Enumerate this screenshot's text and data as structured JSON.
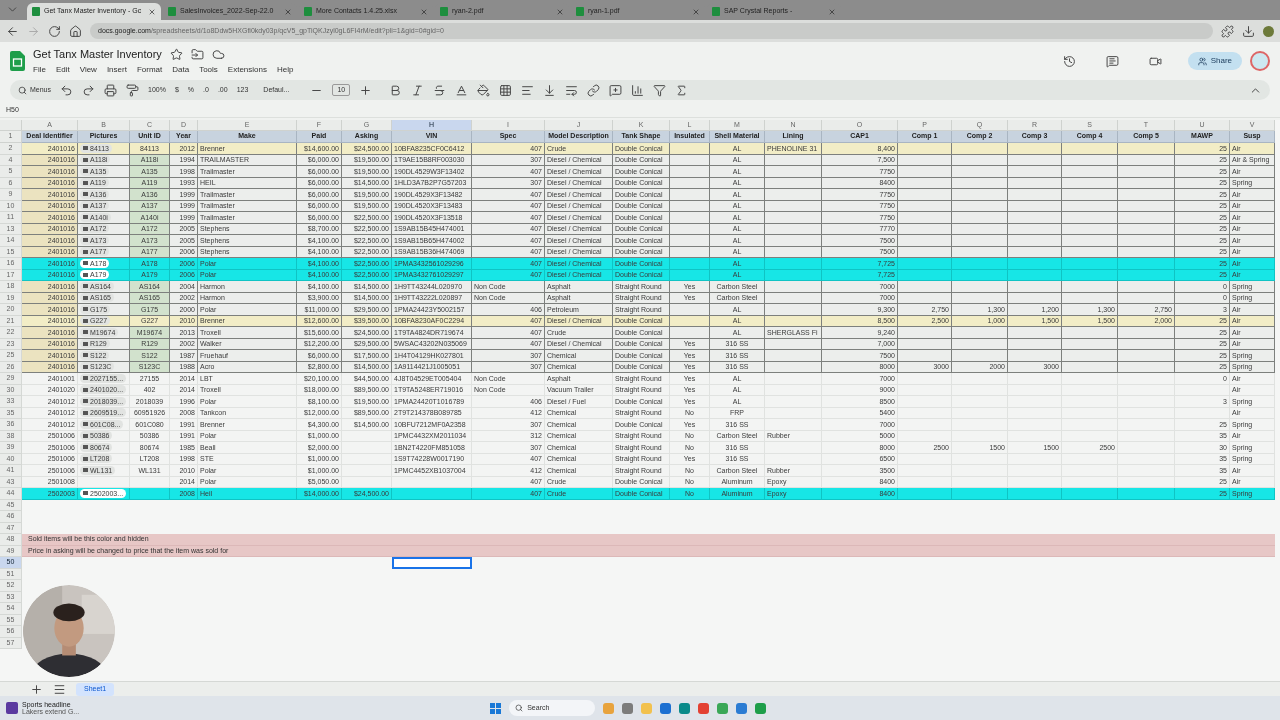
{
  "browser": {
    "tabs": [
      {
        "title": "Get Tanx Master Inventory - Gc",
        "selected": true
      },
      {
        "title": "SalesInvoices_2022-Sep-22.0",
        "selected": false
      },
      {
        "title": "More Contacts 1.4.25.xlsx",
        "selected": false
      },
      {
        "title": "ryan-2.pdf",
        "selected": false
      },
      {
        "title": "ryan-1.pdf",
        "selected": false
      },
      {
        "title": "SAP Crystal Reports -",
        "selected": false
      }
    ],
    "url_host": "docs.google.com",
    "url_path": "/spreadsheets/d/1o8Ddw5HXGfi0kdy03p/qcV5_gpTiQKJzyl0gL6FI4rM/edit?pli=1&gid=0#gid=0"
  },
  "document": {
    "title": "Get Tanx Master Inventory",
    "menus": [
      "File",
      "Edit",
      "View",
      "Insert",
      "Format",
      "Data",
      "Tools",
      "Extensions",
      "Help"
    ],
    "share": "Share"
  },
  "toolbar": {
    "search": "Menus",
    "zoom": "100%",
    "currency": "$",
    "percent": "%",
    "decrease_decimal": ".0",
    "increase_decimal": ".00",
    "number_format": "123",
    "font": "Defaul...",
    "font_size": "10"
  },
  "formula_bar": {
    "cell_ref": "H50"
  },
  "sheet": {
    "header_row": "1",
    "columns": [
      {
        "letter": "A",
        "selected": false,
        "header": "Deal Identifier"
      },
      {
        "letter": "B",
        "selected": false,
        "header": "Pictures"
      },
      {
        "letter": "C",
        "selected": false,
        "header": "Unit ID"
      },
      {
        "letter": "D",
        "selected": false,
        "header": "Year"
      },
      {
        "letter": "E",
        "selected": false,
        "header": "Make"
      },
      {
        "letter": "F",
        "selected": false,
        "header": "Paid"
      },
      {
        "letter": "G",
        "selected": false,
        "header": "Asking"
      },
      {
        "letter": "H",
        "selected": true,
        "header": "VIN"
      },
      {
        "letter": "I",
        "selected": false,
        "header": "Spec"
      },
      {
        "letter": "J",
        "selected": false,
        "header": "Model Description"
      },
      {
        "letter": "K",
        "selected": false,
        "header": "Tank Shape"
      },
      {
        "letter": "L",
        "selected": false,
        "header": "Insulated"
      },
      {
        "letter": "M",
        "selected": false,
        "header": "Shell Material"
      },
      {
        "letter": "N",
        "selected": false,
        "header": "Lining"
      },
      {
        "letter": "O",
        "selected": false,
        "header": "CAP1"
      },
      {
        "letter": "P",
        "selected": false,
        "header": "Comp 1"
      },
      {
        "letter": "Q",
        "selected": false,
        "header": "Comp 2"
      },
      {
        "letter": "R",
        "selected": false,
        "header": "Comp 3"
      },
      {
        "letter": "S",
        "selected": false,
        "header": "Comp 4"
      },
      {
        "letter": "T",
        "selected": false,
        "header": "Comp 5"
      },
      {
        "letter": "U",
        "selected": false,
        "header": "MAWP"
      },
      {
        "letter": "V",
        "selected": false,
        "header": "Susp"
      }
    ],
    "rows": [
      {
        "row": "2",
        "kind": "highlight",
        "selected": false,
        "cells": [
          "2401016",
          "84113",
          "84113",
          "2012",
          "Brenner",
          "$14,600.00",
          "$24,500.00",
          "10BFA8235CF0C6412",
          "407",
          "Crude",
          "Double Conical",
          null,
          "AL",
          "PHENOLINE 31",
          "8,400",
          null,
          null,
          null,
          null,
          null,
          "25",
          "Air"
        ]
      },
      {
        "row": "4",
        "kind": "listed",
        "selected": false,
        "cells": [
          "2401016",
          "A118i",
          "A118i",
          "1994",
          "TRAILMASTER",
          "$6,000.00",
          "$19,500.00",
          "1T9AE15B8RF003030",
          "307",
          "Diesel / Chemical",
          "Double Conical",
          null,
          "AL",
          null,
          "7,500",
          null,
          null,
          null,
          null,
          null,
          "25",
          "Air & Spring"
        ]
      },
      {
        "row": "5",
        "kind": "listed",
        "selected": false,
        "cells": [
          "2401016",
          "A135",
          "A135",
          "1998",
          "Trailmaster",
          "$6,000.00",
          "$19,500.00",
          "190DL4529W3F13402",
          "407",
          "Diesel / Chemical",
          "Double Conical",
          null,
          "AL",
          null,
          "7750",
          null,
          null,
          null,
          null,
          null,
          "25",
          "Air"
        ]
      },
      {
        "row": "6",
        "kind": "listed",
        "selected": false,
        "cells": [
          "2401016",
          "A119",
          "A119",
          "1993",
          "HEIL",
          "$6,000.00",
          "$14,500.00",
          "1HLD3A7B2P7G57203",
          "307",
          "Diesel / Chemical",
          "Double Conical",
          null,
          "AL",
          null,
          "8400",
          null,
          null,
          null,
          null,
          null,
          "25",
          "Spring"
        ]
      },
      {
        "row": "9",
        "kind": "listed",
        "selected": false,
        "cells": [
          "2401016",
          "A136",
          "A136",
          "1999",
          "Trailmaster",
          "$6,000.00",
          "$19,500.00",
          "190DL4529X3F13482",
          "407",
          "Diesel / Chemical",
          "Double Conical",
          null,
          "AL",
          null,
          "7750",
          null,
          null,
          null,
          null,
          null,
          "25",
          "Air"
        ]
      },
      {
        "row": "10",
        "kind": "listed",
        "selected": false,
        "cells": [
          "2401016",
          "A137",
          "A137",
          "1999",
          "Trailmaster",
          "$6,000.00",
          "$19,500.00",
          "190DL4520X3F13483",
          "407",
          "Diesel / Chemical",
          "Double Conical",
          null,
          "AL",
          null,
          "7750",
          null,
          null,
          null,
          null,
          null,
          "25",
          "Air"
        ]
      },
      {
        "row": "11",
        "kind": "listed",
        "selected": false,
        "cells": [
          "2401016",
          "A140i",
          "A140i",
          "1999",
          "Trailmaster",
          "$6,000.00",
          "$22,500.00",
          "190DL4520X3F13518",
          "407",
          "Diesel / Chemical",
          "Double Conical",
          null,
          "AL",
          null,
          "7750",
          null,
          null,
          null,
          null,
          null,
          "25",
          "Air"
        ]
      },
      {
        "row": "13",
        "kind": "listed",
        "selected": false,
        "cells": [
          "2401016",
          "A172",
          "A172",
          "2005",
          "Stephens",
          "$8,700.00",
          "$22,500.00",
          "1S9AB15B45H474001",
          "407",
          "Diesel / Chemical",
          "Double Conical",
          null,
          "AL",
          null,
          "7770",
          null,
          null,
          null,
          null,
          null,
          "25",
          "Air"
        ]
      },
      {
        "row": "14",
        "kind": "listed",
        "selected": false,
        "cells": [
          "2401016",
          "A173",
          "A173",
          "2005",
          "Stephens",
          "$4,100.00",
          "$22,500.00",
          "1S9AB15B65H474002",
          "407",
          "Diesel / Chemical",
          "Double Conical",
          null,
          "AL",
          null,
          "7500",
          null,
          null,
          null,
          null,
          null,
          "25",
          "Air"
        ]
      },
      {
        "row": "15",
        "kind": "listed",
        "selected": false,
        "cells": [
          "2401016",
          "A177",
          "A177",
          "2006",
          "Stephens",
          "$4,100.00",
          "$22,500.00",
          "1S9AB15B36H474069",
          "407",
          "Diesel / Chemical",
          "Double Conical",
          null,
          "AL",
          null,
          "7500",
          null,
          null,
          null,
          null,
          null,
          "25",
          "Air"
        ]
      },
      {
        "row": "16",
        "kind": "sold",
        "selected": false,
        "cells": [
          "2401016",
          "A178",
          "A178",
          "2006",
          "Polar",
          "$4,100.00",
          "$22,500.00",
          "1PMA3432561029296",
          "407",
          "Diesel / Chemical",
          "Double Conical",
          null,
          "AL",
          null,
          "7,725",
          null,
          null,
          null,
          null,
          null,
          "25",
          "Air"
        ]
      },
      {
        "row": "17",
        "kind": "sold",
        "selected": false,
        "cells": [
          "2401016",
          "A179",
          "A179",
          "2006",
          "Polar",
          "$4,100.00",
          "$22,500.00",
          "1PMA3432761029297",
          "407",
          "Diesel / Chemical",
          "Double Conical",
          null,
          "AL",
          null,
          "7,725",
          null,
          null,
          null,
          null,
          null,
          "25",
          "Air"
        ]
      },
      {
        "row": "18",
        "kind": "listed",
        "selected": false,
        "cells": [
          "2401016",
          "AS164",
          "AS164",
          "2004",
          "Harmon",
          "$4,100.00",
          "$14,500.00",
          "1H9TT43244L020970",
          "Non Code",
          "Asphalt",
          "Straight Round",
          "Yes",
          "Carbon Steel",
          null,
          "7000",
          null,
          null,
          null,
          null,
          null,
          "0",
          "Spring"
        ]
      },
      {
        "row": "19",
        "kind": "listed",
        "selected": false,
        "cells": [
          "2401016",
          "AS165",
          "AS165",
          "2002",
          "Harmon",
          "$3,900.00",
          "$14,500.00",
          "1H9TT43222L020897",
          "Non Code",
          "Asphalt",
          "Straight Round",
          "Yes",
          "Carbon Steel",
          null,
          "7000",
          null,
          null,
          null,
          null,
          null,
          "0",
          "Spring"
        ]
      },
      {
        "row": "20",
        "kind": "listed",
        "selected": false,
        "cells": [
          "2401016",
          "G175",
          "G175",
          "2000",
          "Polar",
          "$11,000.00",
          "$29,500.00",
          "1PMA24423Y5002157",
          "406",
          "Petroleum",
          "Straight Round",
          null,
          "AL",
          null,
          "9,300",
          "2,750",
          "1,300",
          "1,200",
          "1,300",
          "2,750",
          "3",
          "Air"
        ]
      },
      {
        "row": "21",
        "kind": "highlight",
        "selected": false,
        "cells": [
          "2401016",
          "G227",
          "G227",
          "2010",
          "Brenner",
          "$12,600.00",
          "$39,500.00",
          "10BFA8230AF0C2294",
          "407",
          "Diesel / Chemical",
          "Double Conical",
          null,
          "AL",
          null,
          "8,500",
          "2,500",
          "1,000",
          "1,500",
          "1,500",
          "2,000",
          "25",
          "Air"
        ]
      },
      {
        "row": "22",
        "kind": "listed",
        "selected": false,
        "cells": [
          "2401016",
          "M19674",
          "M19674",
          "2013",
          "Troxell",
          "$15,600.00",
          "$24,500.00",
          "1T9TA4824DR719674",
          "407",
          "Crude",
          "Double Conical",
          null,
          "AL",
          "SHERGLASS Fi",
          "9,240",
          null,
          null,
          null,
          null,
          null,
          "25",
          "Air"
        ]
      },
      {
        "row": "23",
        "kind": "listed",
        "selected": false,
        "cells": [
          "2401016",
          "R129",
          "R129",
          "2002",
          "Walker",
          "$12,200.00",
          "$29,500.00",
          "5WSAC43202N035069",
          "407",
          "Diesel / Chemical",
          "Double Conical",
          "Yes",
          "316 SS",
          null,
          "7,000",
          null,
          null,
          null,
          null,
          null,
          "25",
          "Air"
        ]
      },
      {
        "row": "25",
        "kind": "listed",
        "selected": false,
        "cells": [
          "2401016",
          "S122",
          "S122",
          "1987",
          "Fruehauf",
          "$6,000.00",
          "$17,500.00",
          "1H4T04129HK027801",
          "307",
          "Chemical",
          "Double Conical",
          "Yes",
          "316 SS",
          null,
          "7500",
          null,
          null,
          null,
          null,
          null,
          "25",
          "Spring"
        ]
      },
      {
        "row": "26",
        "kind": "listed",
        "selected": false,
        "cells": [
          "2401016",
          "S123C",
          "S123C",
          "1988",
          "Acro",
          "$2,800.00",
          "$14,500.00",
          "1A9114421J1005051",
          "307",
          "Chemical",
          "Double Conical",
          "Yes",
          "316 SS",
          null,
          "8000",
          "3000",
          "2000",
          "3000",
          null,
          null,
          "25",
          "Spring"
        ]
      },
      {
        "row": "29",
        "kind": "plain",
        "selected": false,
        "cells": [
          "2401001",
          "2027155...",
          "27155",
          "2014",
          "LBT",
          "$20,100.00",
          "$44,500.00",
          "4J8T04529ET005404",
          "Non Code",
          "Asphalt",
          "Straight Round",
          "Yes",
          "AL",
          null,
          "7000",
          null,
          null,
          null,
          null,
          null,
          "0",
          "Air"
        ]
      },
      {
        "row": "30",
        "kind": "plain",
        "selected": false,
        "cells": [
          "2401020",
          "2401020...",
          "402",
          "2014",
          "Troxell",
          "$18,000.00",
          "$89,500.00",
          "1T9TA5248ER719016",
          "Non Code",
          "Vacuum Trailer",
          "Straight Round",
          "Yes",
          "AL",
          null,
          "9000",
          null,
          null,
          null,
          null,
          null,
          null,
          "Air"
        ]
      },
      {
        "row": "33",
        "kind": "plain",
        "selected": false,
        "cells": [
          "2401012",
          "2018039...",
          "2018039",
          "1996",
          "Polar",
          "$8,100.00",
          "$19,500.00",
          "1PMA24420T1016789",
          "406",
          "Diesel / Fuel",
          "Double Conical",
          "Yes",
          "AL",
          null,
          "8500",
          null,
          null,
          null,
          null,
          null,
          "3",
          "Spring"
        ]
      },
      {
        "row": "35",
        "kind": "plain",
        "selected": false,
        "cells": [
          "2401012",
          "2609519...",
          "60951926",
          "2008",
          "Tankcon",
          "$12,000.00",
          "$89,500.00",
          "2T9T214378B089785",
          "412",
          "Chemical",
          "Straight Round",
          "No",
          "FRP",
          null,
          "5400",
          null,
          null,
          null,
          null,
          null,
          null,
          "Air"
        ]
      },
      {
        "row": "36",
        "kind": "plain",
        "selected": false,
        "cells": [
          "2401012",
          "601C08...",
          "601C080",
          "1991",
          "Brenner",
          "$4,300.00",
          "$14,500.00",
          "10BFU7212MF0A2358",
          "307",
          "Chemical",
          "Double Conical",
          "Yes",
          "316 SS",
          null,
          "7000",
          null,
          null,
          null,
          null,
          null,
          "25",
          "Spring"
        ]
      },
      {
        "row": "38",
        "kind": "plain",
        "selected": false,
        "cells": [
          "2501006",
          "50386",
          "50386",
          "1991",
          "Polar",
          "$1,000.00",
          null,
          "1PMC4432XM2011034",
          "312",
          "Chemical",
          "Straight Round",
          "No",
          "Carbon Steel",
          "Rubber",
          "5000",
          null,
          null,
          null,
          null,
          null,
          "35",
          "Air"
        ]
      },
      {
        "row": "39",
        "kind": "plain",
        "selected": false,
        "cells": [
          "2501006",
          "80674",
          "80674",
          "1985",
          "Beall",
          "$2,000.00",
          null,
          "1BN2T4220FM851058",
          "307",
          "Chemical",
          "Straight Round",
          "No",
          "316 SS",
          null,
          "8000",
          "2500",
          "1500",
          "1500",
          "2500",
          null,
          "30",
          "Spring"
        ]
      },
      {
        "row": "40",
        "kind": "plain",
        "selected": false,
        "cells": [
          "2501006",
          "LT208",
          "LT208",
          "1998",
          "STE",
          "$1,000.00",
          null,
          "1S9T74228W0017190",
          "407",
          "Chemical",
          "Straight Round",
          "Yes",
          "316 SS",
          null,
          "6500",
          null,
          null,
          null,
          null,
          null,
          "35",
          "Spring"
        ]
      },
      {
        "row": "41",
        "kind": "plain",
        "selected": false,
        "cells": [
          "2501006",
          "WL131",
          "WL131",
          "2010",
          "Polar",
          "$1,000.00",
          null,
          "1PMC4452XB1037004",
          "412",
          "Chemical",
          "Straight Round",
          "No",
          "Carbon Steel",
          "Rubber",
          "3500",
          null,
          null,
          null,
          null,
          null,
          "35",
          "Air"
        ]
      },
      {
        "row": "43",
        "kind": "plain",
        "selected": false,
        "cells": [
          "2501008",
          null,
          null,
          "2014",
          "Polar",
          "$5,050.00",
          null,
          null,
          "407",
          "Crude",
          "Double Conical",
          "No",
          "Aluminum",
          "Epoxy",
          "8400",
          null,
          null,
          null,
          null,
          null,
          "25",
          "Air"
        ]
      },
      {
        "row": "44",
        "kind": "sold",
        "selected": false,
        "cells": [
          "2502003",
          "2502003...",
          null,
          "2008",
          "Heil",
          "$14,000.00",
          "$24,500.00",
          null,
          "407",
          "Crude",
          "Double Conical",
          "No",
          "Aluminum",
          "Epoxy",
          "8400",
          null,
          null,
          null,
          null,
          null,
          "25",
          "Spring"
        ]
      },
      {
        "row": "45",
        "kind": "empty",
        "selected": false
      },
      {
        "row": "46",
        "kind": "empty",
        "selected": false
      },
      {
        "row": "47",
        "kind": "empty",
        "selected": false
      },
      {
        "row": "48",
        "kind": "note",
        "selected": false,
        "note": "Sold items will be this color and hidden"
      },
      {
        "row": "49",
        "kind": "note",
        "selected": false,
        "note": "Price in asking will be changed to price that the item was sold for"
      },
      {
        "row": "50",
        "kind": "empty",
        "selected": true
      },
      {
        "row": "51",
        "kind": "empty",
        "selected": false
      },
      {
        "row": "52",
        "kind": "empty",
        "selected": false
      },
      {
        "row": "53",
        "kind": "empty",
        "selected": false
      },
      {
        "row": "54",
        "kind": "empty",
        "selected": false
      },
      {
        "row": "55",
        "kind": "empty",
        "selected": false
      },
      {
        "row": "56",
        "kind": "empty",
        "selected": false
      },
      {
        "row": "57",
        "kind": "empty",
        "selected": false
      }
    ],
    "tabs": [
      {
        "label": "Sheet1",
        "selected": true
      }
    ]
  },
  "taskbar": {
    "news_title": "Sports headline",
    "news_text": "Lakers extend G...",
    "search": "Search"
  }
}
